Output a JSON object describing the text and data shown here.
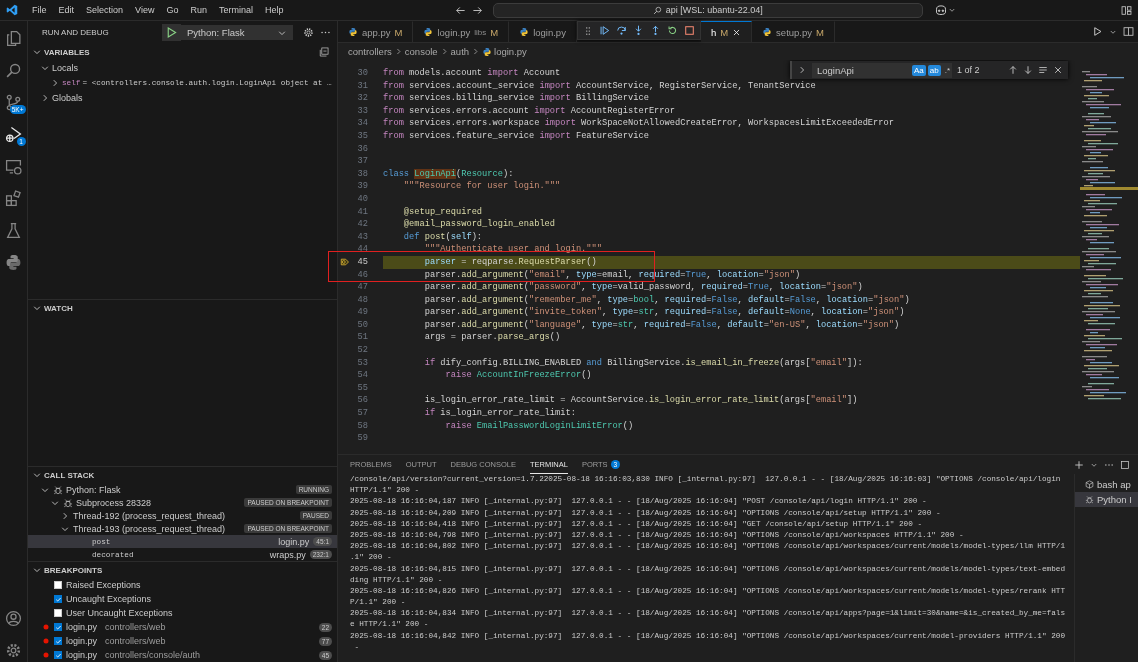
{
  "title_bar": {
    "menus": [
      "File",
      "Edit",
      "Selection",
      "View",
      "Go",
      "Run",
      "Terminal",
      "Help"
    ],
    "search": "api [WSL: ubantu-22.04]"
  },
  "activity_bar": {
    "items": [
      {
        "kind": "explorer",
        "selected": false
      },
      {
        "kind": "search",
        "selected": false
      },
      {
        "kind": "source-control",
        "selected": false,
        "badge": "5K+"
      },
      {
        "kind": "run-debug",
        "selected": true,
        "badge": "1"
      },
      {
        "kind": "remote",
        "selected": false
      },
      {
        "kind": "extensions",
        "selected": false
      },
      {
        "kind": "testing",
        "selected": false
      },
      {
        "kind": "python",
        "selected": false
      }
    ],
    "bottom": [
      {
        "kind": "account",
        "selected": false
      },
      {
        "kind": "settings",
        "selected": false
      }
    ]
  },
  "sidebar": {
    "title": "RUN AND DEBUG",
    "launch_config": "Python: Flask",
    "variables": {
      "title": "VARIABLES",
      "expanded": true,
      "scopes": [
        {
          "label": "Locals",
          "expanded": true,
          "children": [
            {
              "name": "self",
              "value": "= <controllers.console.auth.login.LoginApi object at …",
              "expanded": false
            }
          ]
        },
        {
          "label": "Globals",
          "expanded": false
        }
      ]
    },
    "watch": {
      "title": "WATCH",
      "expanded": true
    },
    "call_stack": {
      "title": "CALL STACK",
      "expanded": true,
      "items": [
        {
          "label": "Python: Flask",
          "status": "RUNNING",
          "expanded": true,
          "children": [
            {
              "label": "Subprocess 28328",
              "status": "PAUSED ON BREAKPOINT",
              "expanded": true,
              "children": [
                {
                  "label": "Thread-192 (process_request_thread)",
                  "status": "PAUSED",
                  "expanded": false
                },
                {
                  "label": "Thread-193 (process_request_thread)",
                  "status": "PAUSED ON BREAKPOINT",
                  "expanded": true,
                  "frames": [
                    {
                      "function": "post",
                      "file": "login.py",
                      "position": "45:1",
                      "selected": true
                    },
                    {
                      "function": "decorated",
                      "file": "wraps.py",
                      "position": "232:1",
                      "selected": false
                    }
                  ]
                }
              ]
            }
          ]
        }
      ]
    },
    "breakpoints": {
      "title": "BREAKPOINTS",
      "expanded": true,
      "items": [
        {
          "kind": "exception",
          "label": "Raised Exceptions",
          "checked": false
        },
        {
          "kind": "exception",
          "label": "Uncaught Exceptions",
          "checked": true
        },
        {
          "kind": "exception",
          "label": "User Uncaught Exceptions",
          "checked": false
        },
        {
          "kind": "file",
          "label": "login.py",
          "path": "controllers/web",
          "line": "22",
          "checked": true
        },
        {
          "kind": "file",
          "label": "login.py",
          "path": "controllers/web",
          "line": "77",
          "checked": true
        },
        {
          "kind": "file",
          "label": "login.py",
          "path": "controllers/console/auth",
          "line": "45",
          "checked": true
        }
      ]
    }
  },
  "editor": {
    "tabs": [
      {
        "label": "app.py",
        "status": "M",
        "selected": false
      },
      {
        "label": "login.py",
        "description": "libs",
        "status": "M",
        "selected": false
      },
      {
        "label": "login.py",
        "selected": false
      },
      {
        "label": "h",
        "status": "M",
        "selected": true
      },
      {
        "label": "setup.py",
        "status": "M",
        "selected": false
      }
    ],
    "breadcrumb": [
      "controllers",
      "console",
      "auth",
      "login.py"
    ],
    "find": {
      "value": "LoginApi",
      "toggles": [
        {
          "label": "Aa",
          "on": true
        },
        {
          "label": "ab",
          "on": true
        },
        {
          "label": ".*",
          "on": false
        }
      ],
      "count": "1 of 2"
    },
    "lines": [
      {
        "number": "30",
        "current": false,
        "tokens": [
          {
            "kind": "k",
            "text": "from"
          },
          {
            "kind": "p",
            "text": " models.account "
          },
          {
            "kind": "k",
            "text": "import"
          },
          {
            "kind": "p",
            "text": " Account"
          }
        ]
      },
      {
        "number": "31",
        "current": false,
        "tokens": [
          {
            "kind": "k",
            "text": "from"
          },
          {
            "kind": "p",
            "text": " services.account_service "
          },
          {
            "kind": "k",
            "text": "import"
          },
          {
            "kind": "p",
            "text": " AccountService, RegisterService, TenantService"
          }
        ]
      },
      {
        "number": "32",
        "current": false,
        "tokens": [
          {
            "kind": "k",
            "text": "from"
          },
          {
            "kind": "p",
            "text": " services.billing_service "
          },
          {
            "kind": "k",
            "text": "import"
          },
          {
            "kind": "p",
            "text": " BillingService"
          }
        ]
      },
      {
        "number": "33",
        "current": false,
        "tokens": [
          {
            "kind": "k",
            "text": "from"
          },
          {
            "kind": "p",
            "text": " services.errors.account "
          },
          {
            "kind": "k",
            "text": "import"
          },
          {
            "kind": "p",
            "text": " AccountRegisterError"
          }
        ]
      },
      {
        "number": "34",
        "current": false,
        "tokens": [
          {
            "kind": "k",
            "text": "from"
          },
          {
            "kind": "p",
            "text": " services.errors.workspace "
          },
          {
            "kind": "k",
            "text": "import"
          },
          {
            "kind": "p",
            "text": " WorkSpaceNotAllowedCreateError, WorkspacesLimitExceededError"
          }
        ]
      },
      {
        "number": "35",
        "current": false,
        "tokens": [
          {
            "kind": "k",
            "text": "from"
          },
          {
            "kind": "p",
            "text": " services.feature_service "
          },
          {
            "kind": "k",
            "text": "import"
          },
          {
            "kind": "p",
            "text": " FeatureService"
          }
        ]
      },
      {
        "number": "36",
        "current": false
      },
      {
        "number": "37",
        "current": false
      },
      {
        "number": "38",
        "current": false,
        "tokens": [
          {
            "kind": "d",
            "text": "class "
          },
          {
            "kind": "m",
            "text": "LoginApi"
          },
          {
            "kind": "p",
            "text": "("
          },
          {
            "kind": "t",
            "text": "Resource"
          },
          {
            "kind": "p",
            "text": "):"
          }
        ]
      },
      {
        "number": "39",
        "current": false,
        "tokens": [
          {
            "kind": "s",
            "text": "    \"\"\"Resource for user login.\"\"\""
          }
        ]
      },
      {
        "number": "40",
        "current": false
      },
      {
        "number": "41",
        "current": false,
        "tokens": [
          {
            "kind": "f",
            "text": "    @setup_required"
          }
        ]
      },
      {
        "number": "42",
        "current": false,
        "tokens": [
          {
            "kind": "f",
            "text": "    @email_password_login_enabled"
          }
        ]
      },
      {
        "number": "43",
        "current": false,
        "tokens": [
          {
            "kind": "d",
            "text": "    def "
          },
          {
            "kind": "f",
            "text": "post"
          },
          {
            "kind": "p",
            "text": "("
          },
          {
            "kind": "v",
            "text": "self"
          },
          {
            "kind": "p",
            "text": "):"
          }
        ]
      },
      {
        "number": "44",
        "current": false,
        "tokens": [
          {
            "kind": "s",
            "text": "        \"\"\"Authenticate user and login.\"\"\""
          }
        ]
      },
      {
        "number": "45",
        "current": true,
        "tokens": [
          {
            "kind": "v",
            "text": "        parser"
          },
          {
            "kind": "p",
            "text": " = reqparse."
          },
          {
            "kind": "f",
            "text": "RequestParser"
          },
          {
            "kind": "p",
            "text": "()"
          }
        ]
      },
      {
        "number": "46",
        "current": false,
        "tokens": [
          {
            "kind": "p",
            "text": "        parser."
          },
          {
            "kind": "f",
            "text": "add_argument"
          },
          {
            "kind": "p",
            "text": "("
          },
          {
            "kind": "s",
            "text": "\"email\""
          },
          {
            "kind": "p",
            "text": ", "
          },
          {
            "kind": "v",
            "text": "type"
          },
          {
            "kind": "p",
            "text": "=email, "
          },
          {
            "kind": "v",
            "text": "required"
          },
          {
            "kind": "p",
            "text": "="
          },
          {
            "kind": "d",
            "text": "True"
          },
          {
            "kind": "p",
            "text": ", "
          },
          {
            "kind": "v",
            "text": "location"
          },
          {
            "kind": "p",
            "text": "="
          },
          {
            "kind": "s",
            "text": "\"json\""
          },
          {
            "kind": "p",
            "text": ")"
          }
        ]
      },
      {
        "number": "47",
        "current": false,
        "tokens": [
          {
            "kind": "p",
            "text": "        parser."
          },
          {
            "kind": "f",
            "text": "add_argument"
          },
          {
            "kind": "p",
            "text": "("
          },
          {
            "kind": "s",
            "text": "\"password\""
          },
          {
            "kind": "p",
            "text": ", "
          },
          {
            "kind": "v",
            "text": "type"
          },
          {
            "kind": "p",
            "text": "=valid_password, "
          },
          {
            "kind": "v",
            "text": "required"
          },
          {
            "kind": "p",
            "text": "="
          },
          {
            "kind": "d",
            "text": "True"
          },
          {
            "kind": "p",
            "text": ", "
          },
          {
            "kind": "v",
            "text": "location"
          },
          {
            "kind": "p",
            "text": "="
          },
          {
            "kind": "s",
            "text": "\"json\""
          },
          {
            "kind": "p",
            "text": ")"
          }
        ]
      },
      {
        "number": "48",
        "current": false,
        "tokens": [
          {
            "kind": "p",
            "text": "        parser."
          },
          {
            "kind": "f",
            "text": "add_argument"
          },
          {
            "kind": "p",
            "text": "("
          },
          {
            "kind": "s",
            "text": "\"remember_me\""
          },
          {
            "kind": "p",
            "text": ", "
          },
          {
            "kind": "v",
            "text": "type"
          },
          {
            "kind": "p",
            "text": "="
          },
          {
            "kind": "t",
            "text": "bool"
          },
          {
            "kind": "p",
            "text": ", "
          },
          {
            "kind": "v",
            "text": "required"
          },
          {
            "kind": "p",
            "text": "="
          },
          {
            "kind": "d",
            "text": "False"
          },
          {
            "kind": "p",
            "text": ", "
          },
          {
            "kind": "v",
            "text": "default"
          },
          {
            "kind": "p",
            "text": "="
          },
          {
            "kind": "d",
            "text": "False"
          },
          {
            "kind": "p",
            "text": ", "
          },
          {
            "kind": "v",
            "text": "location"
          },
          {
            "kind": "p",
            "text": "="
          },
          {
            "kind": "s",
            "text": "\"json\""
          },
          {
            "kind": "p",
            "text": ")"
          }
        ]
      },
      {
        "number": "49",
        "current": false,
        "tokens": [
          {
            "kind": "p",
            "text": "        parser."
          },
          {
            "kind": "f",
            "text": "add_argument"
          },
          {
            "kind": "p",
            "text": "("
          },
          {
            "kind": "s",
            "text": "\"invite_token\""
          },
          {
            "kind": "p",
            "text": ", "
          },
          {
            "kind": "v",
            "text": "type"
          },
          {
            "kind": "p",
            "text": "="
          },
          {
            "kind": "t",
            "text": "str"
          },
          {
            "kind": "p",
            "text": ", "
          },
          {
            "kind": "v",
            "text": "required"
          },
          {
            "kind": "p",
            "text": "="
          },
          {
            "kind": "d",
            "text": "False"
          },
          {
            "kind": "p",
            "text": ", "
          },
          {
            "kind": "v",
            "text": "default"
          },
          {
            "kind": "p",
            "text": "="
          },
          {
            "kind": "d",
            "text": "None"
          },
          {
            "kind": "p",
            "text": ", "
          },
          {
            "kind": "v",
            "text": "location"
          },
          {
            "kind": "p",
            "text": "="
          },
          {
            "kind": "s",
            "text": "\"json\""
          },
          {
            "kind": "p",
            "text": ")"
          }
        ]
      },
      {
        "number": "50",
        "current": false,
        "tokens": [
          {
            "kind": "p",
            "text": "        parser."
          },
          {
            "kind": "f",
            "text": "add_argument"
          },
          {
            "kind": "p",
            "text": "("
          },
          {
            "kind": "s",
            "text": "\"language\""
          },
          {
            "kind": "p",
            "text": ", "
          },
          {
            "kind": "v",
            "text": "type"
          },
          {
            "kind": "p",
            "text": "="
          },
          {
            "kind": "t",
            "text": "str"
          },
          {
            "kind": "p",
            "text": ", "
          },
          {
            "kind": "v",
            "text": "required"
          },
          {
            "kind": "p",
            "text": "="
          },
          {
            "kind": "d",
            "text": "False"
          },
          {
            "kind": "p",
            "text": ", "
          },
          {
            "kind": "v",
            "text": "default"
          },
          {
            "kind": "p",
            "text": "="
          },
          {
            "kind": "s",
            "text": "\"en-US\""
          },
          {
            "kind": "p",
            "text": ", "
          },
          {
            "kind": "v",
            "text": "location"
          },
          {
            "kind": "p",
            "text": "="
          },
          {
            "kind": "s",
            "text": "\"json\""
          },
          {
            "kind": "p",
            "text": ")"
          }
        ]
      },
      {
        "number": "51",
        "current": false,
        "tokens": [
          {
            "kind": "p",
            "text": "        args = parser."
          },
          {
            "kind": "f",
            "text": "parse_args"
          },
          {
            "kind": "p",
            "text": "()"
          }
        ]
      },
      {
        "number": "52",
        "current": false
      },
      {
        "number": "53",
        "current": false,
        "tokens": [
          {
            "kind": "k",
            "text": "        if"
          },
          {
            "kind": "p",
            "text": " dify_config.BILLING_ENABLED "
          },
          {
            "kind": "d",
            "text": "and"
          },
          {
            "kind": "p",
            "text": " BillingService."
          },
          {
            "kind": "f",
            "text": "is_email_in_freeze"
          },
          {
            "kind": "p",
            "text": "(args["
          },
          {
            "kind": "s",
            "text": "\"email\""
          },
          {
            "kind": "p",
            "text": "]):"
          }
        ]
      },
      {
        "number": "54",
        "current": false,
        "tokens": [
          {
            "kind": "k",
            "text": "            raise "
          },
          {
            "kind": "t",
            "text": "AccountInFreezeError"
          },
          {
            "kind": "p",
            "text": "()"
          }
        ]
      },
      {
        "number": "55",
        "current": false
      },
      {
        "number": "56",
        "current": false,
        "tokens": [
          {
            "kind": "p",
            "text": "        is_login_error_rate_limit = AccountService."
          },
          {
            "kind": "f",
            "text": "is_login_error_rate_limit"
          },
          {
            "kind": "p",
            "text": "(args["
          },
          {
            "kind": "s",
            "text": "\"email\""
          },
          {
            "kind": "p",
            "text": "])"
          }
        ]
      },
      {
        "number": "57",
        "current": false,
        "tokens": [
          {
            "kind": "k",
            "text": "        if"
          },
          {
            "kind": "p",
            "text": " is_login_error_rate_limit:"
          }
        ]
      },
      {
        "number": "58",
        "current": false,
        "tokens": [
          {
            "kind": "k",
            "text": "            raise "
          },
          {
            "kind": "t",
            "text": "EmailPasswordLoginLimitError"
          },
          {
            "kind": "p",
            "text": "()"
          }
        ]
      },
      {
        "number": "59",
        "current": false
      }
    ]
  },
  "panel": {
    "tabs": [
      {
        "label": "PROBLEMS",
        "selected": false
      },
      {
        "label": "OUTPUT",
        "selected": false
      },
      {
        "label": "DEBUG CONSOLE",
        "selected": false
      },
      {
        "label": "TERMINAL",
        "selected": true
      },
      {
        "label": "PORTS",
        "selected": false,
        "badge": "3"
      }
    ],
    "terminal_lines": [
      "/console/api/version?current_version=1.7.22025-08-18 16:16:03,830 INFO [_internal.py:97]  127.0.0.1 - - [18/Aug/2025 16:16:03] \"OPTIONS /console/api/login",
      "HTTP/1.1\" 200 -",
      "2025-08-18 16:16:04,187 INFO [_internal.py:97]  127.0.0.1 - - [18/Aug/2025 16:16:04] \"POST /console/api/login HTTP/1.1\" 200 -",
      "2025-08-18 16:16:04,209 INFO [_internal.py:97]  127.0.0.1 - - [18/Aug/2025 16:16:04] \"OPTIONS /console/api/setup HTTP/1.1\" 200 -",
      "2025-08-18 16:16:04,418 INFO [_internal.py:97]  127.0.0.1 - - [18/Aug/2025 16:16:04] \"GET /console/api/setup HTTP/1.1\" 200 -",
      "2025-08-18 16:16:04,798 INFO [_internal.py:97]  127.0.0.1 - - [18/Aug/2025 16:16:04] \"OPTIONS /console/api/workspaces HTTP/1.1\" 200 -",
      "2025-08-18 16:16:04,802 INFO [_internal.py:97]  127.0.0.1 - - [18/Aug/2025 16:16:04] \"OPTIONS /console/api/workspaces/current/models/model-types/llm HTTP/1",
      ".1\" 200 -",
      "2025-08-18 16:16:04,815 INFO [_internal.py:97]  127.0.0.1 - - [18/Aug/2025 16:16:04] \"OPTIONS /console/api/workspaces/current/models/model-types/text-embed",
      "ding HTTP/1.1\" 200 -",
      "2025-08-18 16:16:04,826 INFO [_internal.py:97]  127.0.0.1 - - [18/Aug/2025 16:16:04] \"OPTIONS /console/api/workspaces/current/models/model-types/rerank HTT",
      "P/1.1\" 200 -",
      "2025-08-18 16:16:04,834 INFO [_internal.py:97]  127.0.0.1 - - [18/Aug/2025 16:16:04] \"OPTIONS /console/api/apps?page=1&limit=30&name=&is_created_by_me=fals",
      "e HTTP/1.1\" 200 -",
      "2025-08-18 16:16:04,842 INFO [_internal.py:97]  127.0.0.1 - - [18/Aug/2025 16:16:04] \"OPTIONS /console/api/workspaces/current/model-providers HTTP/1.1\" 200",
      " -"
    ],
    "terminals": [
      {
        "kind": "shell",
        "label": "bash ap",
        "selected": false
      },
      {
        "kind": "debug",
        "label": "Python I",
        "selected": true
      }
    ]
  }
}
